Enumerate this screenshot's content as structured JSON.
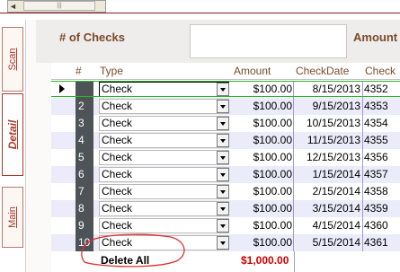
{
  "tabs": {
    "scan": "Scan",
    "detail": "Detail",
    "main": "Main"
  },
  "scrollbar": {
    "left_arrow": "◄",
    "thumb_grip": "|||"
  },
  "header": {
    "checks_label": "# of Checks",
    "checks_value": "",
    "amount_label": "Amount"
  },
  "grid": {
    "columns": [
      "#",
      "Type",
      "Amount",
      "CheckDate",
      "Check"
    ],
    "rows": [
      {
        "num": "",
        "type": "Check",
        "amount": "$100.00",
        "date": "8/15/2013",
        "check": "4352"
      },
      {
        "num": "2",
        "type": "Check",
        "amount": "$100.00",
        "date": "9/15/2013",
        "check": "4353"
      },
      {
        "num": "3",
        "type": "Check",
        "amount": "$100.00",
        "date": "10/15/2013",
        "check": "4354"
      },
      {
        "num": "4",
        "type": "Check",
        "amount": "$100.00",
        "date": "11/15/2013",
        "check": "4355"
      },
      {
        "num": "5",
        "type": "Check",
        "amount": "$100.00",
        "date": "12/15/2013",
        "check": "4356"
      },
      {
        "num": "6",
        "type": "Check",
        "amount": "$100.00",
        "date": "1/15/2014",
        "check": "4357"
      },
      {
        "num": "7",
        "type": "Check",
        "amount": "$100.00",
        "date": "2/15/2014",
        "check": "4358"
      },
      {
        "num": "8",
        "type": "Check",
        "amount": "$100.00",
        "date": "3/15/2014",
        "check": "4359"
      },
      {
        "num": "9",
        "type": "Check",
        "amount": "$100.00",
        "date": "4/15/2014",
        "check": "4360"
      },
      {
        "num": "10",
        "type": "Check",
        "amount": "$100.00",
        "date": "5/15/2014",
        "check": "4361"
      }
    ]
  },
  "footer": {
    "delete_all": "Delete All",
    "total": "$1,000.00"
  },
  "colors": {
    "label_brown": "#7a4b2a",
    "tab_red": "#a83a2a",
    "total_red": "#cc0000",
    "row_alt": "#ebebf9",
    "active_green": "#2bb32b",
    "annotation_red": "#e03030"
  }
}
